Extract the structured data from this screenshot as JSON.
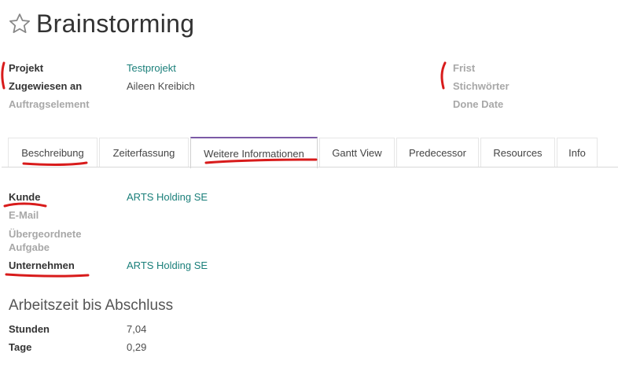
{
  "header": {
    "title": "Brainstorming"
  },
  "info": {
    "left": [
      {
        "label": "Projekt",
        "value": "Testprojekt"
      },
      {
        "label": "Zugewiesen an",
        "value": "Aileen Kreibich"
      },
      {
        "label": "Auftragselement",
        "value": ""
      }
    ],
    "right": [
      {
        "label": "Frist"
      },
      {
        "label": "Stichwörter"
      },
      {
        "label": "Done Date"
      }
    ]
  },
  "tabs": [
    {
      "label": "Beschreibung"
    },
    {
      "label": "Zeiterfassung"
    },
    {
      "label": "Weitere Informationen"
    },
    {
      "label": "Gantt View"
    },
    {
      "label": "Predecessor"
    },
    {
      "label": "Resources"
    },
    {
      "label": "Info"
    }
  ],
  "details": [
    {
      "label": "Kunde",
      "value": "ARTS Holding SE"
    },
    {
      "label": "E-Mail",
      "value": ""
    },
    {
      "label": "Übergeordnete Aufgabe",
      "value": ""
    },
    {
      "label": "Unternehmen",
      "value": "ARTS Holding SE"
    }
  ],
  "worktime": {
    "title": "Arbeitszeit bis Abschluss",
    "rows": [
      {
        "label": "Stunden",
        "value": "7,04"
      },
      {
        "label": "Tage",
        "value": "0,29"
      }
    ]
  },
  "colors": {
    "accent": "#7c5aa6",
    "link": "#1a7f7a",
    "annotation": "#d81b1b"
  }
}
